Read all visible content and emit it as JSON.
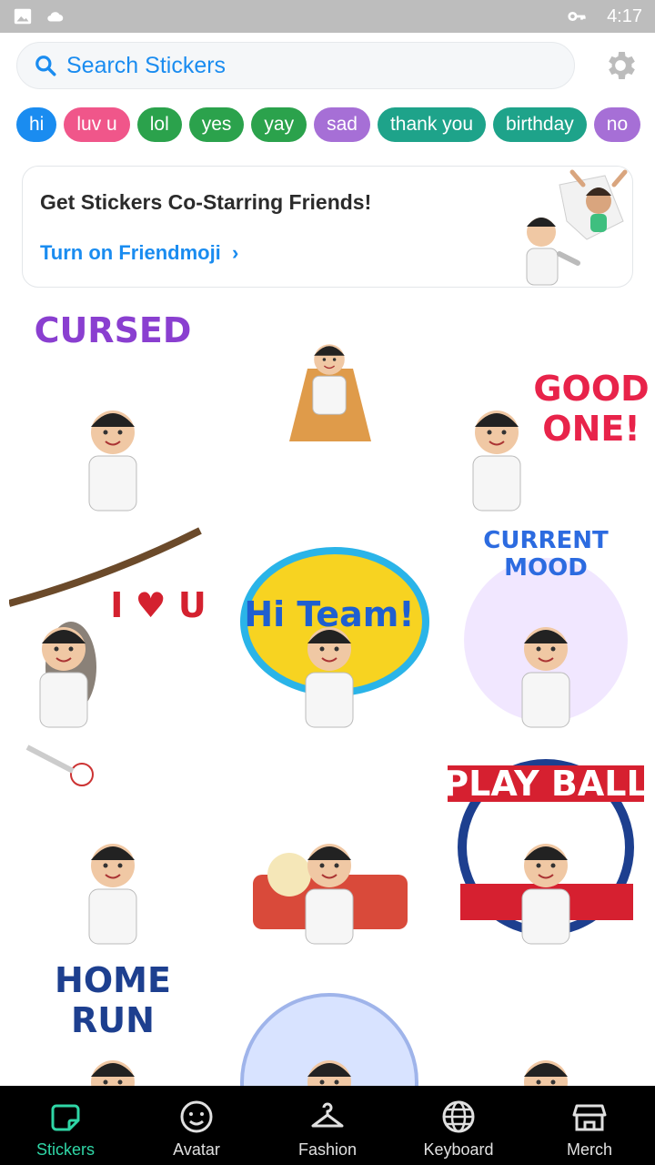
{
  "status_bar": {
    "time": "4:17",
    "icons": [
      "image-icon",
      "cloud-icon",
      "key-icon"
    ]
  },
  "search": {
    "placeholder": "Search Stickers",
    "settings_icon": "gear-icon"
  },
  "chips": [
    {
      "label": "hi",
      "color": "#1a8cf0"
    },
    {
      "label": "luv u",
      "color": "#f0568a"
    },
    {
      "label": "lol",
      "color": "#2ba24c"
    },
    {
      "label": "yes",
      "color": "#2ba24c"
    },
    {
      "label": "yay",
      "color": "#2ba24c"
    },
    {
      "label": "sad",
      "color": "#a66fd6"
    },
    {
      "label": "thank you",
      "color": "#1ea38a"
    },
    {
      "label": "birthday",
      "color": "#1ea38a"
    },
    {
      "label": "no",
      "color": "#a66fd6"
    }
  ],
  "friendmoji_card": {
    "title": "Get Stickers Co-Starring Friends!",
    "link": "Turn on Friendmoji"
  },
  "stickers": [
    {
      "name": "cursed",
      "caption": "CURSED"
    },
    {
      "name": "fairy",
      "caption": ""
    },
    {
      "name": "good-one",
      "caption": "GOOD ONE!"
    },
    {
      "name": "i-love-u",
      "caption": "I ♥ U"
    },
    {
      "name": "hi-team",
      "caption": "Hi Team!"
    },
    {
      "name": "current-mood",
      "caption": "CURRENT MOOD"
    },
    {
      "name": "baseball-phone",
      "caption": ""
    },
    {
      "name": "ballpark-snacks",
      "caption": ""
    },
    {
      "name": "play-ball",
      "caption": "PLAY BALL"
    },
    {
      "name": "home-run",
      "caption": "HOME RUN"
    },
    {
      "name": "bubble",
      "caption": ""
    },
    {
      "name": "cat-costume",
      "caption": ""
    }
  ],
  "bottom_nav": {
    "items": [
      {
        "label": "Stickers",
        "icon": "sticker-icon",
        "active": true
      },
      {
        "label": "Avatar",
        "icon": "face-icon",
        "active": false
      },
      {
        "label": "Fashion",
        "icon": "hanger-icon",
        "active": false
      },
      {
        "label": "Keyboard",
        "icon": "globe-icon",
        "active": false
      },
      {
        "label": "Merch",
        "icon": "store-icon",
        "active": false
      }
    ]
  },
  "colors": {
    "accent": "#1a8cf0",
    "active_nav": "#2fd6a6"
  }
}
